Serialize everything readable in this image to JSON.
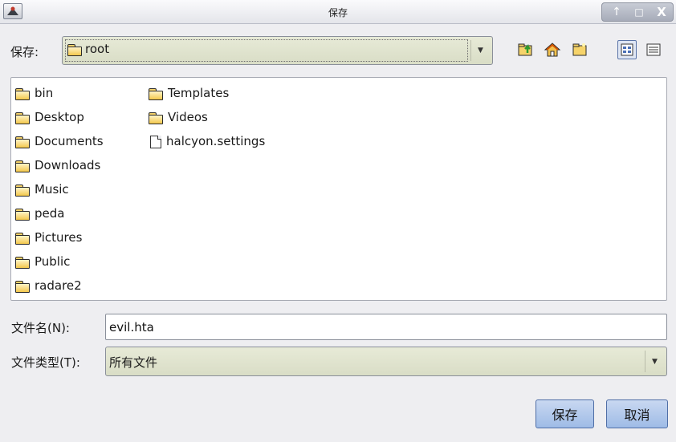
{
  "window": {
    "title": "保存",
    "controls": {
      "up": "↑",
      "maximize": "□",
      "close": "X"
    }
  },
  "location": {
    "label": "保存:",
    "current": "root",
    "icons": [
      "folder-up-icon",
      "home-icon",
      "new-folder-icon",
      "list-view-icon",
      "details-view-icon"
    ]
  },
  "files": {
    "column1": [
      {
        "name": "bin",
        "type": "folder"
      },
      {
        "name": "Desktop",
        "type": "folder"
      },
      {
        "name": "Documents",
        "type": "folder"
      },
      {
        "name": "Downloads",
        "type": "folder"
      },
      {
        "name": "Music",
        "type": "folder"
      },
      {
        "name": "peda",
        "type": "folder"
      },
      {
        "name": "Pictures",
        "type": "folder"
      },
      {
        "name": "Public",
        "type": "folder"
      },
      {
        "name": "radare2",
        "type": "folder"
      }
    ],
    "column2": [
      {
        "name": "Templates",
        "type": "folder"
      },
      {
        "name": "Videos",
        "type": "folder"
      },
      {
        "name": "halcyon.settings",
        "type": "file"
      }
    ]
  },
  "form": {
    "filename_label": "文件名(N):",
    "filename_value": "evil.hta",
    "filetype_label": "文件类型(T):",
    "filetype_value": "所有文件"
  },
  "buttons": {
    "save": "保存",
    "cancel": "取消"
  },
  "colors": {
    "combo_bg": "#dfe2cc",
    "button_bg": "#b4c9ec",
    "accent": "#4f6ea6"
  }
}
